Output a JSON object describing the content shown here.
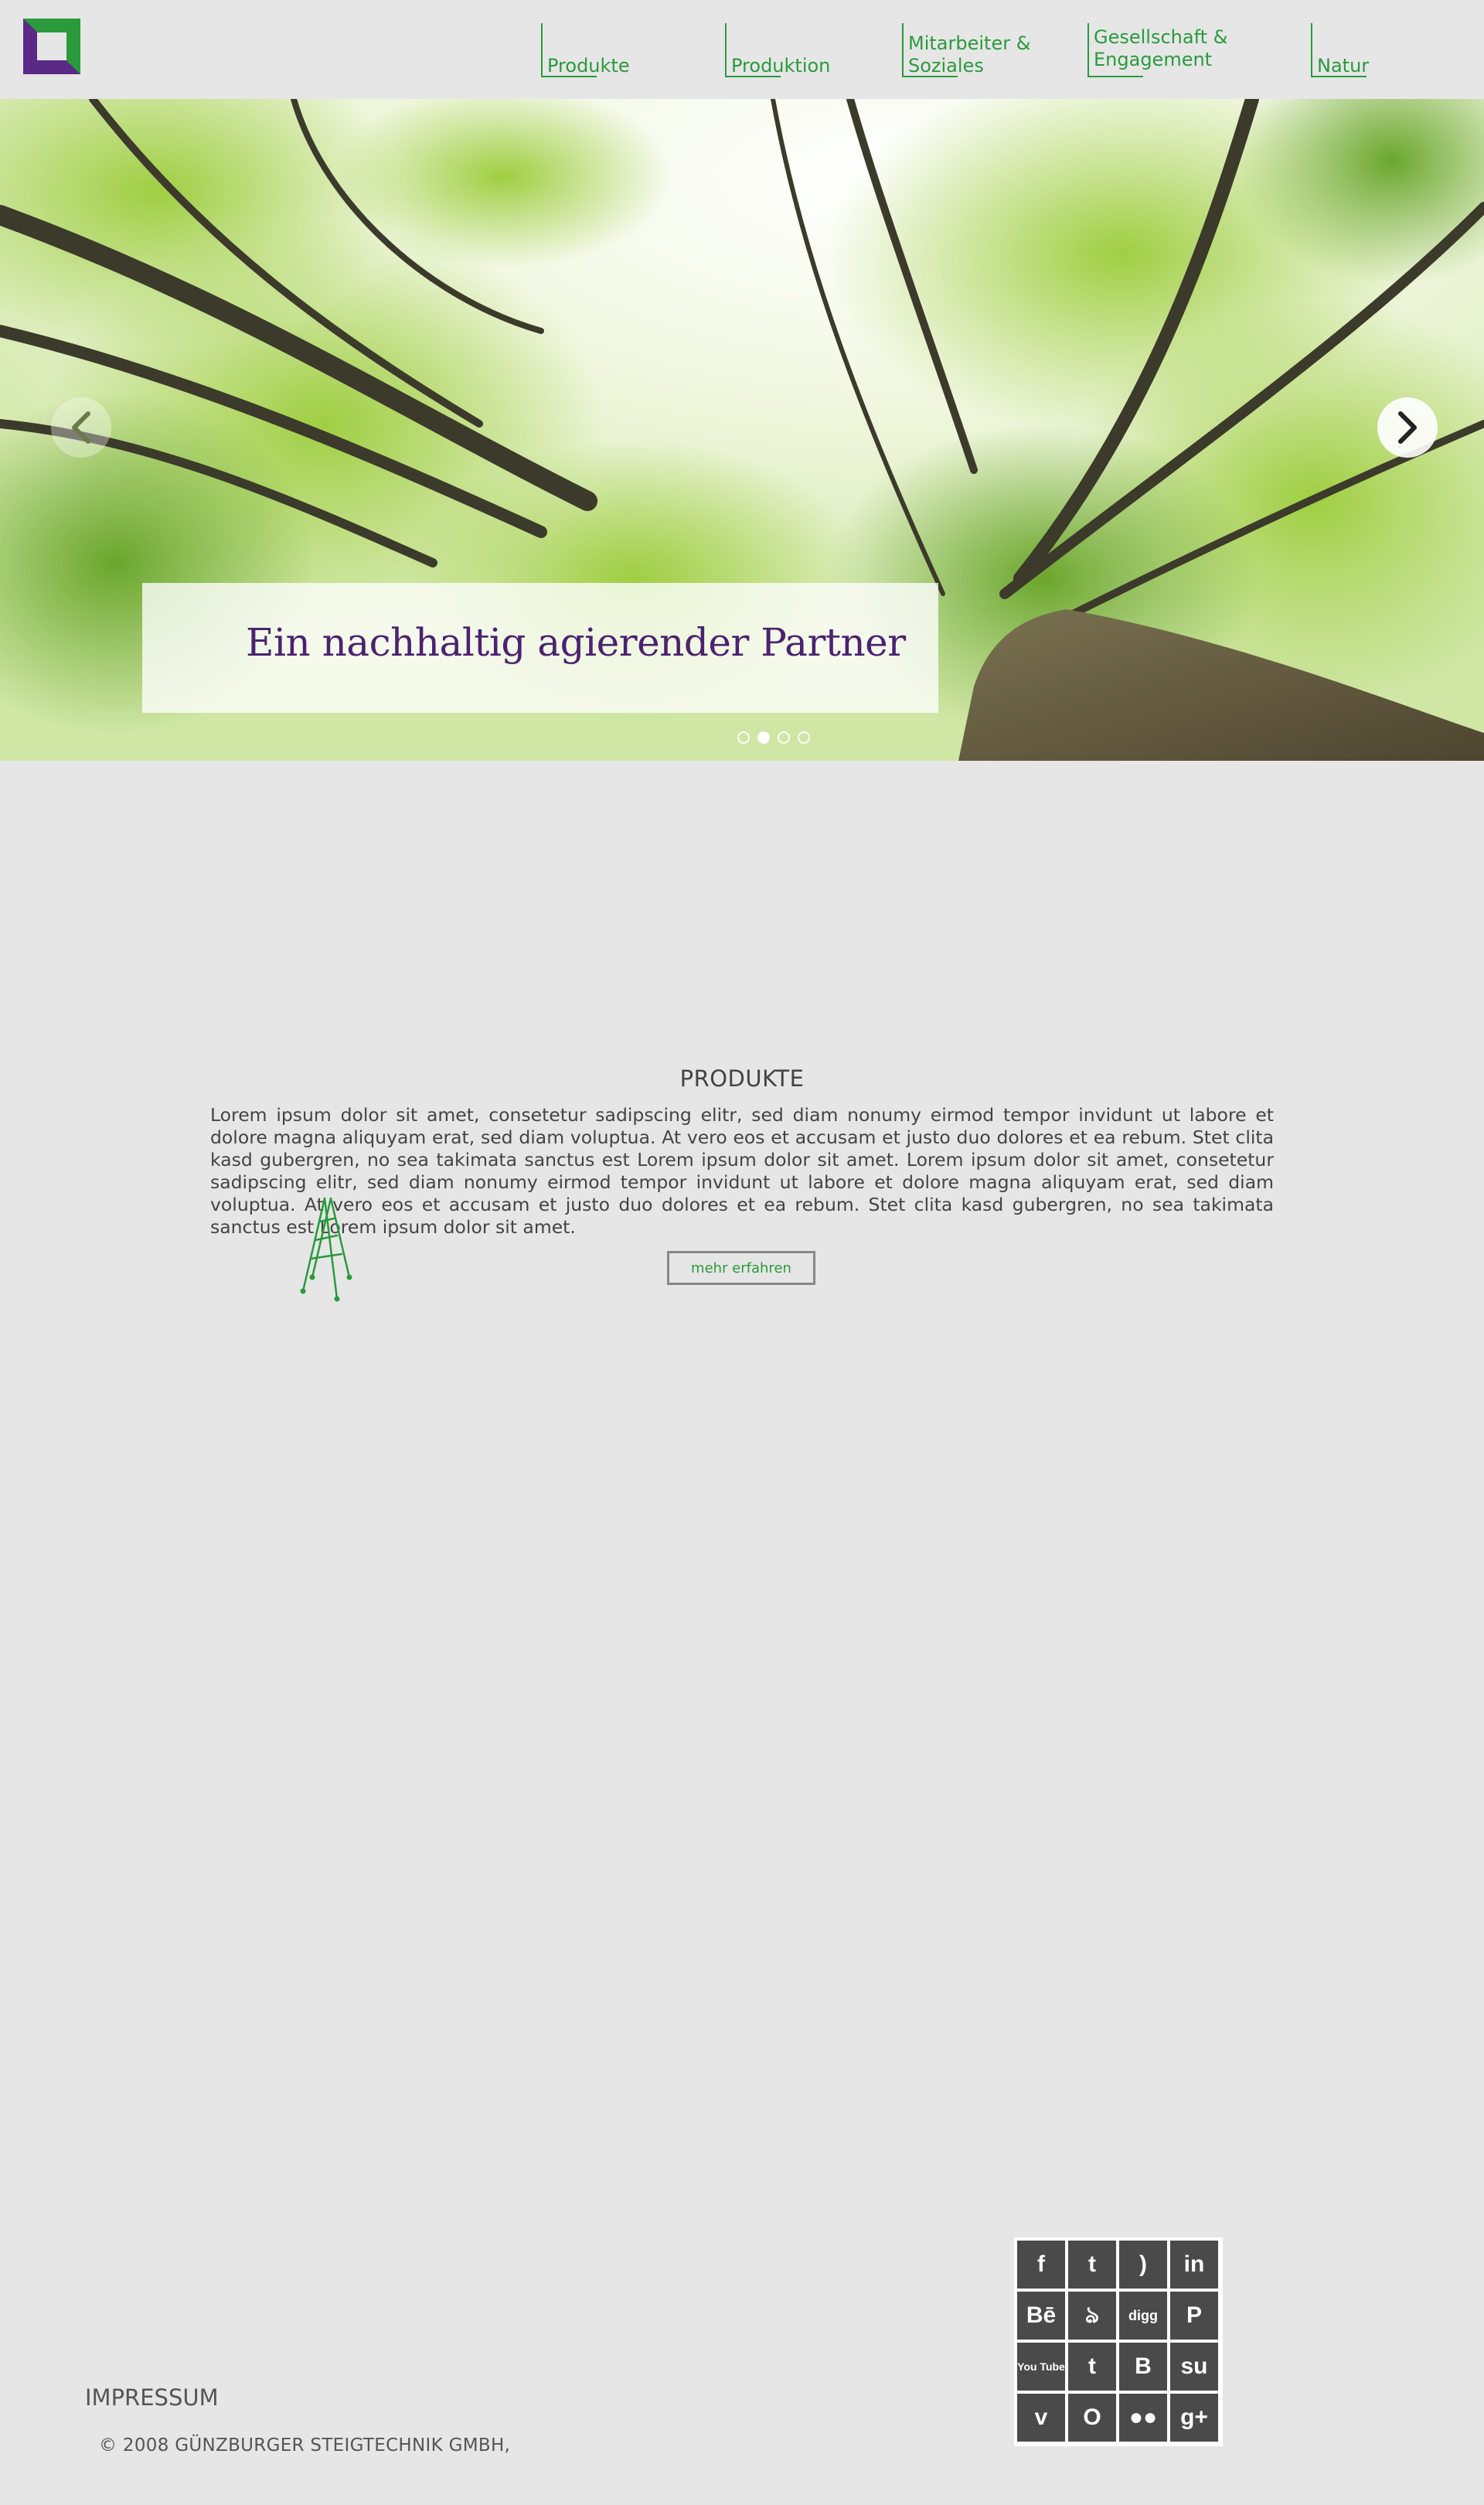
{
  "nav": {
    "items": [
      {
        "line1": "Produkte",
        "line2": ""
      },
      {
        "line1": "Produktion",
        "line2": ""
      },
      {
        "line1": "Mitarbeiter &",
        "line2": "Soziales"
      },
      {
        "line1": "Gesellschaft &",
        "line2": "Engagement"
      },
      {
        "line1": "Natur",
        "line2": ""
      }
    ]
  },
  "hero": {
    "caption": "Ein nachhaltig agierender Partner",
    "slide_count": 4,
    "active_slide": 2
  },
  "products": {
    "title": "PRODUKTE",
    "text": "Lorem ipsum dolor sit amet, consetetur sadipscing elitr, sed diam nonumy eirmod tempor invidunt ut labore et dolore magna aliquyam erat, sed diam voluptua. At vero eos et accusam et justo duo dolores et ea rebum. Stet clita kasd gubergren, no sea takimata sanctus est Lorem ipsum dolor sit amet. Lorem ipsum dolor sit amet, consetetur sadipscing elitr, sed diam nonumy eirmod tempor invidunt ut labore et dolore magna aliquyam erat, sed diam voluptua. At vero eos et accusam et justo duo dolores et ea rebum. Stet clita kasd gubergren, no sea takimata sanctus est Lorem ipsum dolor sit amet.",
    "button": "mehr erfahren"
  },
  "social": [
    {
      "name": "facebook-icon",
      "glyph": "f"
    },
    {
      "name": "twitter-icon",
      "glyph": "t"
    },
    {
      "name": "rss-icon",
      "glyph": ")"
    },
    {
      "name": "linkedin-icon",
      "glyph": "in"
    },
    {
      "name": "behance-icon",
      "glyph": "Bē"
    },
    {
      "name": "deviantart-icon",
      "glyph": "ঌ"
    },
    {
      "name": "digg-icon",
      "glyph": "digg"
    },
    {
      "name": "pinterest-icon",
      "glyph": "P"
    },
    {
      "name": "youtube-icon",
      "glyph": "You Tube"
    },
    {
      "name": "tumblr-icon",
      "glyph": "t"
    },
    {
      "name": "blogger-icon",
      "glyph": "B"
    },
    {
      "name": "stumbleupon-icon",
      "glyph": "su"
    },
    {
      "name": "vimeo-icon",
      "glyph": "v"
    },
    {
      "name": "ring-icon",
      "glyph": "O"
    },
    {
      "name": "flickr-icon",
      "glyph": "●●"
    },
    {
      "name": "googleplus-icon",
      "glyph": "g+"
    }
  ],
  "footer": {
    "impressum": "IMPRESSUM",
    "copyright": "© 2008 GÜNZBURGER STEIGTECHNIK GMBH,"
  },
  "colors": {
    "accent_green": "#2a9a3c",
    "caption_purple": "#4b2270",
    "background": "#e6e6e6"
  }
}
